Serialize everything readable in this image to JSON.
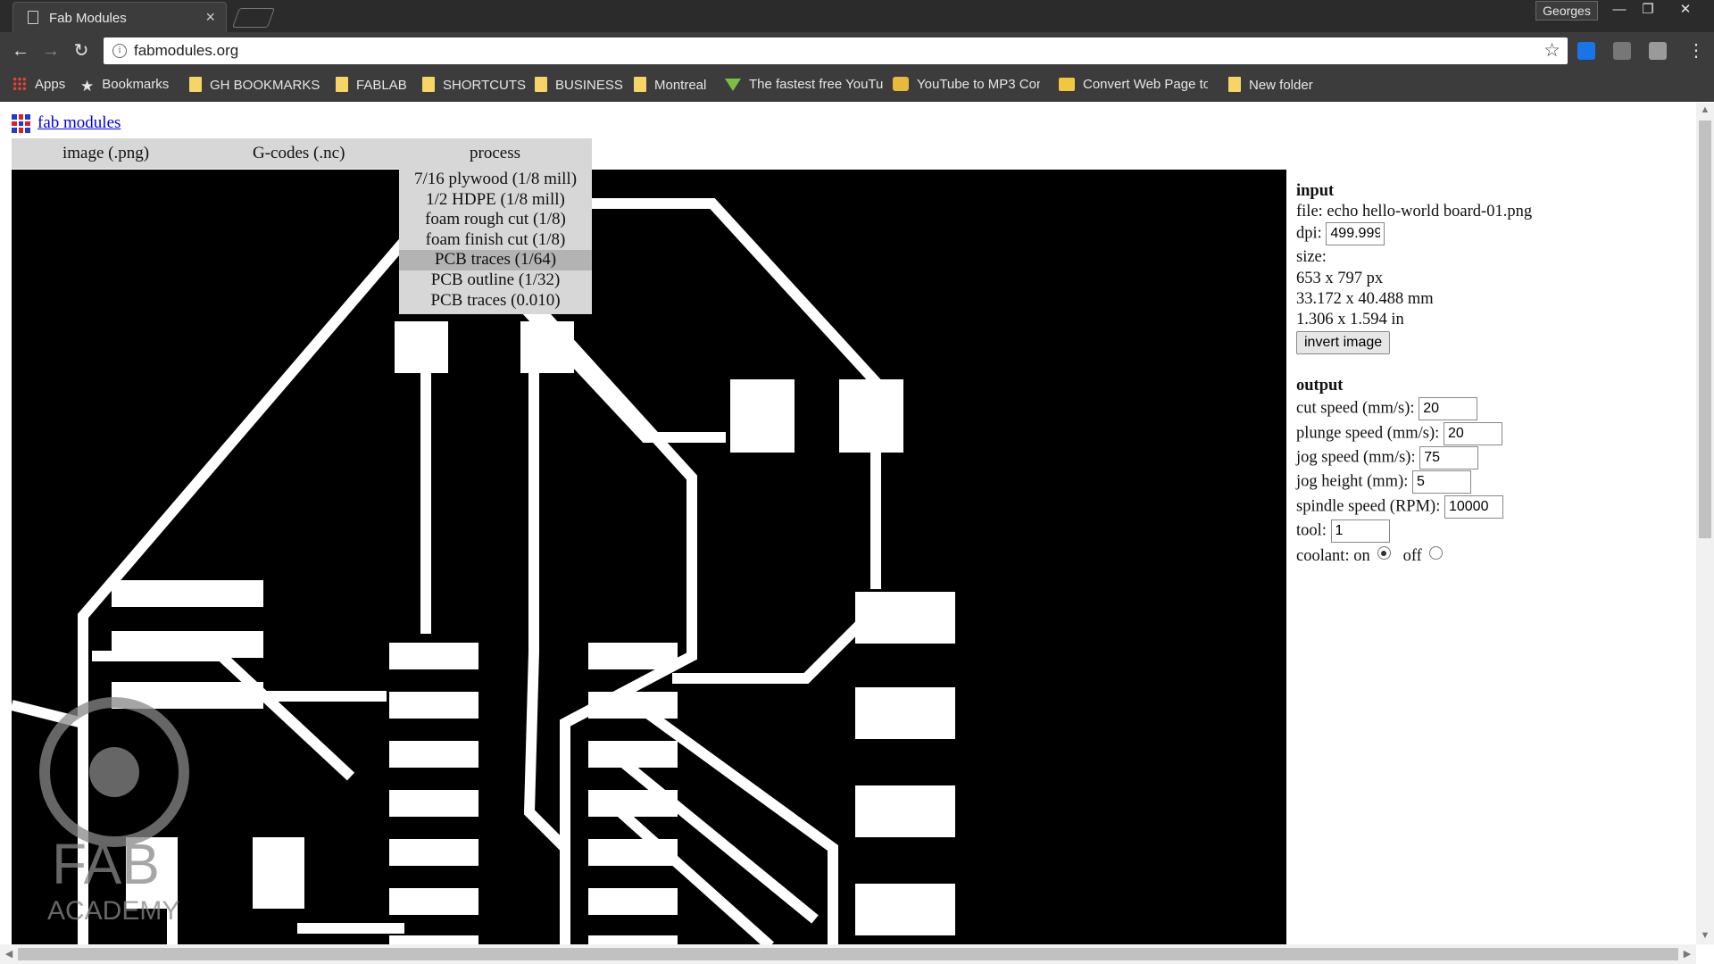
{
  "browser": {
    "tab_title": "Fab Modules",
    "tab_close": "×",
    "profile_name": "Georges",
    "window_controls": {
      "minimize": "—",
      "restore": "❐",
      "close": "✕"
    },
    "nav": {
      "back": "←",
      "forward": "→",
      "reload": "↻"
    },
    "url": "fabmodules.org",
    "star": "☆",
    "menu": "⋮",
    "bookmarks": [
      {
        "label": "Apps",
        "icon": "apps-grid-icon"
      },
      {
        "label": "Bookmarks",
        "icon": "star-icon"
      },
      {
        "label": "GH BOOKMARKS",
        "icon": "folder-icon"
      },
      {
        "label": "FABLAB",
        "icon": "folder-icon"
      },
      {
        "label": "SHORTCUTS",
        "icon": "folder-icon"
      },
      {
        "label": "BUSINESS",
        "icon": "folder-icon"
      },
      {
        "label": "Montreal",
        "icon": "folder-icon"
      },
      {
        "label": "The fastest free YouTu",
        "icon": "download-arrow-icon"
      },
      {
        "label": "YouTube to MP3 Con",
        "icon": "film-icon"
      },
      {
        "label": "Convert Web Page to",
        "icon": "converter-icon"
      },
      {
        "label": "New folder",
        "icon": "folder-icon"
      }
    ]
  },
  "page": {
    "site_title": "fab modules",
    "menu": {
      "image": "image (.png)",
      "gcodes": "G-codes (.nc)",
      "process": "process"
    },
    "process_options": [
      "7/16 plywood (1/8 mill)",
      "1/2 HDPE (1/8 mill)",
      "foam rough cut (1/8)",
      "foam finish cut (1/8)",
      "PCB traces (1/64)",
      "PCB outline (1/32)",
      "PCB traces (0.010)"
    ],
    "selected_process": "PCB traces (1/64)",
    "watermark": {
      "line1": "FAB",
      "line2": "ACADEMY"
    },
    "input": {
      "heading": "input",
      "file_label": "file:",
      "file_name": "echo hello-world board-01.png",
      "dpi_label": "dpi:",
      "dpi_value": "499.999",
      "size_label": "size:",
      "size_px": "653 x 797 px",
      "size_mm": "33.172 x 40.488 mm",
      "size_in": "1.306 x 1.594 in",
      "invert_button": "invert image"
    },
    "output": {
      "heading": "output",
      "cut_speed_label": "cut speed (mm/s):",
      "cut_speed": "20",
      "plunge_speed_label": "plunge speed (mm/s):",
      "plunge_speed": "20",
      "jog_speed_label": "jog speed (mm/s):",
      "jog_speed": "75",
      "jog_height_label": "jog height (mm):",
      "jog_height": "5",
      "spindle_speed_label": "spindle speed (RPM):",
      "spindle_speed": "10000",
      "tool_label": "tool:",
      "tool": "1",
      "coolant_label": "coolant: on",
      "coolant_off_label": "off",
      "coolant_state": "on"
    }
  }
}
